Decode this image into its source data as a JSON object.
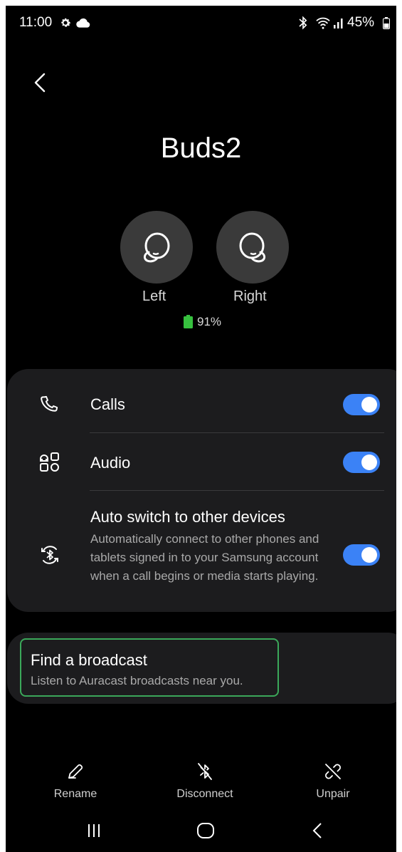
{
  "status_bar": {
    "time": "11:00",
    "battery": "45%",
    "icons": [
      "gear-icon",
      "cloud-icon",
      "bluetooth-icon",
      "wifi-icon",
      "signal-icon",
      "battery-icon"
    ]
  },
  "header": {
    "device_name": "Buds2"
  },
  "buds": {
    "left_label": "Left",
    "right_label": "Right",
    "battery": "91%",
    "battery_color": "#37c13f"
  },
  "settings": [
    {
      "title": "Calls",
      "icon": "phone-icon",
      "enabled": true
    },
    {
      "title": "Audio",
      "icon": "audio-apps-icon",
      "enabled": true
    },
    {
      "title": "Auto switch to other devices",
      "description": "Automatically connect to other phones and tablets signed in to your Samsung account when a call begins or media starts playing.",
      "icon": "bluetooth-switch-icon",
      "enabled": true
    }
  ],
  "broadcast": {
    "title": "Find a broadcast",
    "description": "Listen to Auracast broadcasts near you."
  },
  "bottom_actions": [
    {
      "label": "Rename",
      "icon": "pencil-icon"
    },
    {
      "label": "Disconnect",
      "icon": "bluetooth-off-icon"
    },
    {
      "label": "Unpair",
      "icon": "unlink-icon"
    }
  ],
  "colors": {
    "toggle_on": "#3b82f6",
    "card_bg": "#1c1c1e",
    "focus_outline": "#3ba85a"
  },
  "nav": [
    "recent-apps-icon",
    "home-icon",
    "back-icon"
  ]
}
